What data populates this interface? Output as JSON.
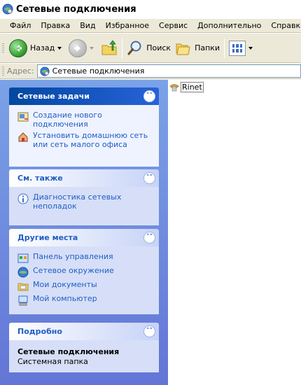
{
  "window": {
    "title": "Сетевые подключения"
  },
  "menu": [
    "Файл",
    "Правка",
    "Вид",
    "Избранное",
    "Сервис",
    "Дополнительно",
    "Справка"
  ],
  "toolbar": {
    "back_label": "Назад",
    "search_label": "Поиск",
    "folders_label": "Папки"
  },
  "address": {
    "label": "Адрес:",
    "value": "Сетевые подключения"
  },
  "panels": {
    "network_tasks": {
      "title": "Сетевые задачи",
      "items": [
        "Создание нового подключения",
        "Установить домашнюю сеть или сеть малого офиса"
      ]
    },
    "see_also": {
      "title": "См. также",
      "items": [
        "Диагностика сетевых неполадок"
      ]
    },
    "other_places": {
      "title": "Другие места",
      "items": [
        "Панель управления",
        "Сетевое окружение",
        "Мои документы",
        "Мой компьютер"
      ]
    },
    "details": {
      "title": "Подробно",
      "name": "Сетевые подключения",
      "type": "Системная папка"
    }
  },
  "content": {
    "items": [
      "Rinet"
    ]
  },
  "colors": {
    "pane_gradient_top": "#7ba2e7",
    "pane_gradient_bottom": "#6375d6",
    "link": "#215dc6",
    "menu_bg": "#ece9d8"
  }
}
